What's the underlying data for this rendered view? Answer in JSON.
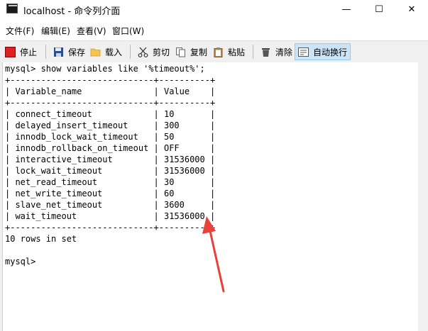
{
  "window": {
    "title": "localhost - 命令列介面",
    "minimize_glyph": "—",
    "maximize_glyph": "☐",
    "close_glyph": "✕"
  },
  "menu": [
    "文件(F)",
    "编辑(E)",
    "查看(V)",
    "窗口(W)"
  ],
  "toolbar": {
    "stop": "停止",
    "save": "保存",
    "load": "载入",
    "cut": "剪切",
    "copy": "复制",
    "paste": "粘贴",
    "clear": "清除",
    "word_wrap": "自动换行"
  },
  "console": {
    "lines": [
      "mysql> show variables like '%timeout%';",
      "+----------------------------+----------+",
      "| Variable_name              | Value    |",
      "+----------------------------+----------+",
      "| connect_timeout            | 10       |",
      "| delayed_insert_timeout     | 300      |",
      "| innodb_lock_wait_timeout   | 50       |",
      "| innodb_rollback_on_timeout | OFF      |",
      "| interactive_timeout        | 31536000 |",
      "| lock_wait_timeout          | 31536000 |",
      "| net_read_timeout           | 30       |",
      "| net_write_timeout          | 60       |",
      "| slave_net_timeout          | 3600     |",
      "| wait_timeout               | 31536000 |",
      "+----------------------------+----------+",
      "10 rows in set",
      "",
      "mysql>"
    ]
  },
  "annotation": {
    "arrow_color": "#e8413a"
  }
}
